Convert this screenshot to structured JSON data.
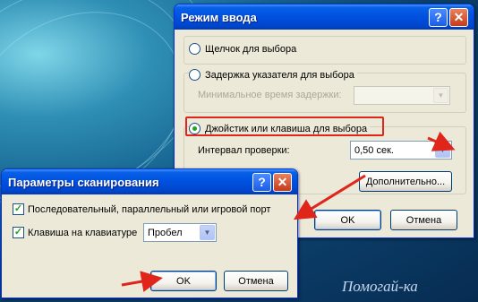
{
  "mode_dialog": {
    "title": "Режим ввода",
    "radio_click": "Щелчок для выбора",
    "radio_hover": "Задержка указателя для выбора",
    "min_delay_label": "Минимальное время задержки:",
    "radio_joystick": "Джойстик или клавиша для выбора",
    "interval_label": "Интервал проверки:",
    "interval_value": "0,50 сек.",
    "advanced_button": "Дополнительно...",
    "ok_button": "OK",
    "cancel_button": "Отмена"
  },
  "scan_dialog": {
    "title": "Параметры сканирования",
    "check_ports": "Последовательный, параллельный или игровой порт",
    "check_keyboard": "Клавиша на клавиатуре",
    "key_value": "Пробел",
    "ok_button": "OK",
    "cancel_button": "Отмена"
  },
  "title_buttons": {
    "help": "?",
    "close": "✕"
  },
  "watermark": "Помогай-ка",
  "colors": {
    "highlight": "#e0251b",
    "titlebar": "#0054e3",
    "dialog_bg": "#ece9d8"
  },
  "icons": [
    "help-icon",
    "close-icon",
    "chevron-down-icon",
    "arrow-annotation"
  ]
}
